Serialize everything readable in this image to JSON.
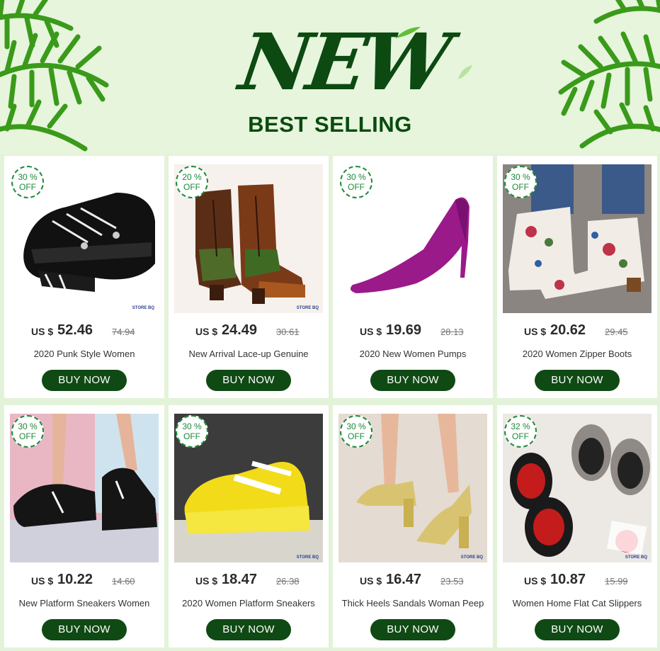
{
  "banner": {
    "headline": "NEW",
    "subheadline": "BEST SELLING"
  },
  "colors": {
    "brand_green": "#0f4a14",
    "discount_green": "#1a8a38",
    "background": "#e3f3d9"
  },
  "products": [
    {
      "discount_pct": "30 %",
      "discount_label": "OFF",
      "currency": "US $",
      "price": "52.46",
      "old_price": "74.94",
      "title": "2020 Punk Style Women",
      "button": "BUY NOW",
      "store_tag": "STORE BQ",
      "image": "black-platform-sneakers"
    },
    {
      "discount_pct": "20 %",
      "discount_label": "OFF",
      "currency": "US $",
      "price": "24.49",
      "old_price": "30.61",
      "title": "New Arrival Lace-up Genuine",
      "button": "BUY NOW",
      "store_tag": "STORE BQ",
      "image": "lace-up-leather-boots"
    },
    {
      "discount_pct": "30 %",
      "discount_label": "OFF",
      "currency": "US $",
      "price": "19.69",
      "old_price": "28.13",
      "title": "2020 New Women Pumps",
      "button": "BUY NOW",
      "store_tag": "",
      "image": "purple-suede-pump"
    },
    {
      "discount_pct": "30 %",
      "discount_label": "OFF",
      "currency": "US $",
      "price": "20.62",
      "old_price": "29.45",
      "title": "2020 Women Zipper Boots",
      "button": "BUY NOW",
      "store_tag": "",
      "image": "floral-ankle-boots"
    },
    {
      "discount_pct": "30 %",
      "discount_label": "OFF",
      "currency": "US $",
      "price": "10.22",
      "old_price": "14.60",
      "title": "New Platform Sneakers Women",
      "button": "BUY NOW",
      "store_tag": "",
      "image": "black-knit-sneakers"
    },
    {
      "discount_pct": "30 %",
      "discount_label": "OFF",
      "currency": "US $",
      "price": "18.47",
      "old_price": "26.38",
      "title": "2020 Women Platform Sneakers",
      "button": "BUY NOW",
      "store_tag": "STORE BQ",
      "image": "yellow-chunky-sneakers"
    },
    {
      "discount_pct": "30 %",
      "discount_label": "OFF",
      "currency": "US $",
      "price": "16.47",
      "old_price": "23.53",
      "title": "Thick Heels Sandals Woman Peep",
      "button": "BUY NOW",
      "store_tag": "STORE BQ",
      "image": "gold-peep-toe-sandals"
    },
    {
      "discount_pct": "32 %",
      "discount_label": "OFF",
      "currency": "US $",
      "price": "10.87",
      "old_price": "15.99",
      "title": "Women Home Flat Cat Slippers",
      "button": "BUY NOW",
      "store_tag": "STORE BQ",
      "image": "cat-slippers"
    }
  ]
}
